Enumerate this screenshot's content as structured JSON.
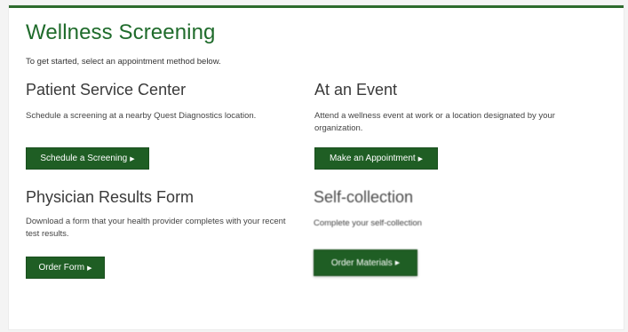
{
  "header": {
    "title": "Wellness Screening",
    "intro": "To get started, select an appointment method below."
  },
  "sections": [
    {
      "heading": "Patient Service Center",
      "description": "Schedule a screening at a nearby Quest Diagnostics location.",
      "button_label": "Schedule a Screening"
    },
    {
      "heading": "At an Event",
      "description": "Attend a wellness event at work or a location designated by your organization.",
      "button_label": "Make an Appointment"
    },
    {
      "heading": "Physician Results Form",
      "description": "Download a form that your health provider completes with your recent test results.",
      "button_label": "Order Form"
    },
    {
      "heading": "Self-collection",
      "description": "Complete your self-collection",
      "button_label": "Order Materials"
    }
  ],
  "icons": {
    "button_arrow": "caret-right-icon"
  },
  "colors": {
    "brand_green": "#1f6b2b",
    "button_green": "#1f5e24"
  }
}
